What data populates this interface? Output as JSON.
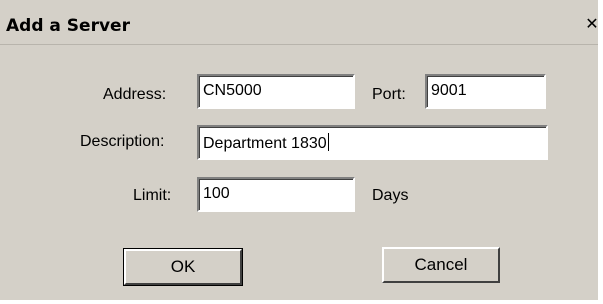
{
  "dialog": {
    "title": "Add a Server",
    "close_glyph": "✕"
  },
  "form": {
    "address_label": "Address:",
    "address_value": "CN5000",
    "port_label": "Port:",
    "port_value": "9001",
    "description_label": "Description:",
    "description_value": "Department 1830",
    "limit_label": "Limit:",
    "limit_value": "100",
    "limit_unit": "Days"
  },
  "buttons": {
    "ok": "OK",
    "cancel": "Cancel"
  }
}
